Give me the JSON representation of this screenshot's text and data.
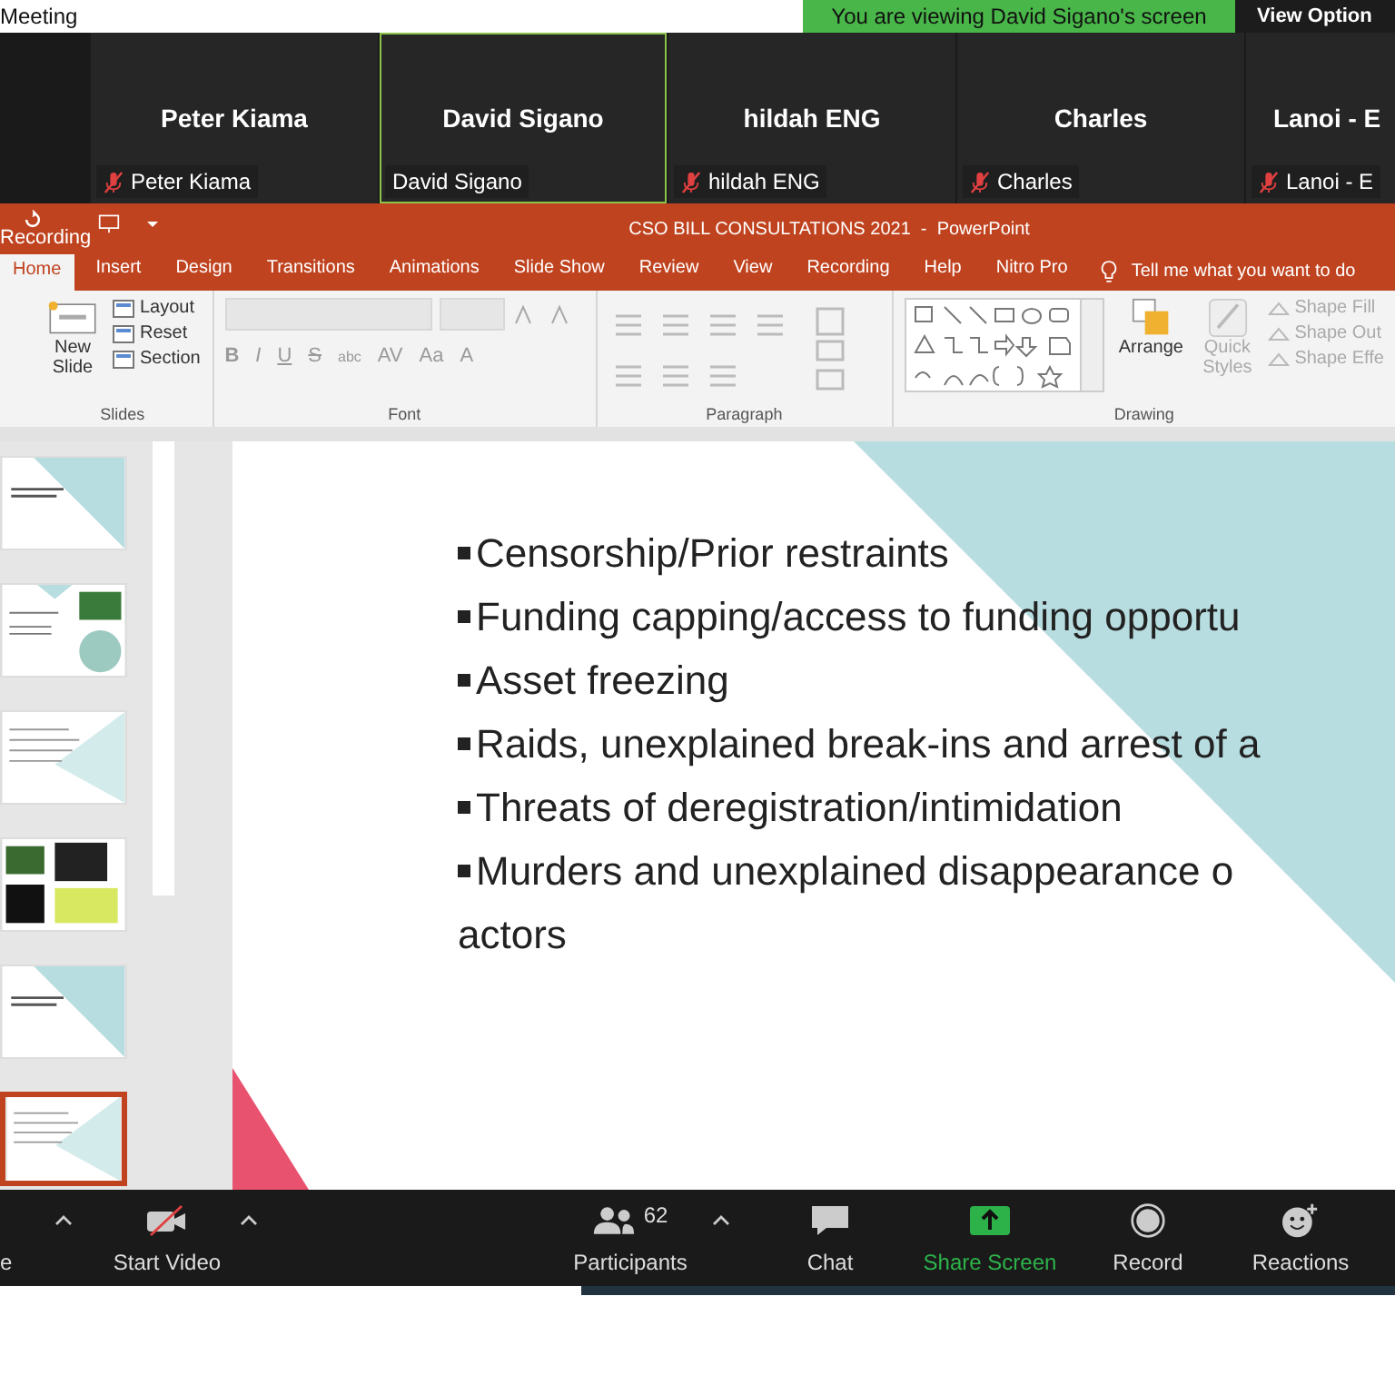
{
  "meeting_bar": {
    "title": "Meeting",
    "banner": "You are viewing David Sigano's screen",
    "view_options": "View Option"
  },
  "participants": [
    {
      "name": "Peter Kiama",
      "label": "Peter Kiama",
      "muted": true,
      "selected": false
    },
    {
      "name": "David Sigano",
      "label": "David Sigano",
      "muted": false,
      "selected": true
    },
    {
      "name": "hildah ENG",
      "label": "hildah ENG",
      "muted": true,
      "selected": false
    },
    {
      "name": "Charles",
      "label": "Charles",
      "muted": true,
      "selected": false
    },
    {
      "name": "Lanoi - E",
      "label": "Lanoi - E",
      "muted": true,
      "selected": false
    }
  ],
  "powerpoint": {
    "recording_label": "Recording",
    "title": "CSO BILL CONSULTATIONS 2021  -  PowerPoint",
    "tabs": [
      {
        "label": "Home",
        "selected": true
      },
      {
        "label": "Insert",
        "selected": false
      },
      {
        "label": "Design",
        "selected": false
      },
      {
        "label": "Transitions",
        "selected": false
      },
      {
        "label": "Animations",
        "selected": false
      },
      {
        "label": "Slide Show",
        "selected": false
      },
      {
        "label": "Review",
        "selected": false
      },
      {
        "label": "View",
        "selected": false
      },
      {
        "label": "Recording",
        "selected": false
      },
      {
        "label": "Help",
        "selected": false
      },
      {
        "label": "Nitro Pro",
        "selected": false
      }
    ],
    "tell_me": "Tell me what you want to do",
    "ribbon": {
      "slides": {
        "group": "Slides",
        "new_slide": "New Slide",
        "commands": [
          "Layout",
          "Reset",
          "Section"
        ]
      },
      "font": {
        "group": "Font",
        "buttons": [
          "B",
          "I",
          "U",
          "S",
          "abc",
          "AV",
          "Aa",
          "A"
        ]
      },
      "paragraph": {
        "group": "Paragraph"
      },
      "drawing": {
        "group": "Drawing",
        "arrange": "Arrange",
        "quick_styles": "Quick Styles",
        "commands": [
          "Shape Fill",
          "Shape Out",
          "Shape Effe"
        ]
      }
    }
  },
  "thumbnails": [
    {
      "kind": "title",
      "selected": false
    },
    {
      "kind": "image",
      "selected": false
    },
    {
      "kind": "text",
      "selected": false
    },
    {
      "kind": "collage",
      "selected": false
    },
    {
      "kind": "title",
      "selected": false
    },
    {
      "kind": "text",
      "selected": true
    }
  ],
  "slide": {
    "lines": [
      {
        "text": "Censorship/Prior restraints",
        "bullet": true
      },
      {
        "text": "Funding capping/access to funding opportu",
        "bullet": true
      },
      {
        "text": "Asset freezing",
        "bullet": true
      },
      {
        "text": "Raids, unexplained break-ins and arrest of a",
        "bullet": true
      },
      {
        "text": "Threats of deregistration/intimidation",
        "bullet": true
      },
      {
        "text": "Murders and unexplained disappearance o",
        "bullet": true
      },
      {
        "text": "actors",
        "bullet": false
      }
    ]
  },
  "toolbar": [
    {
      "kind": "unmute",
      "label": "e"
    },
    {
      "kind": "video",
      "label": "Start Video"
    },
    {
      "kind": "participants",
      "label": "Participants",
      "count": "62"
    },
    {
      "kind": "chat",
      "label": "Chat"
    },
    {
      "kind": "share",
      "label": "Share Screen"
    },
    {
      "kind": "record",
      "label": "Record"
    },
    {
      "kind": "reactions",
      "label": "Reactions"
    }
  ]
}
